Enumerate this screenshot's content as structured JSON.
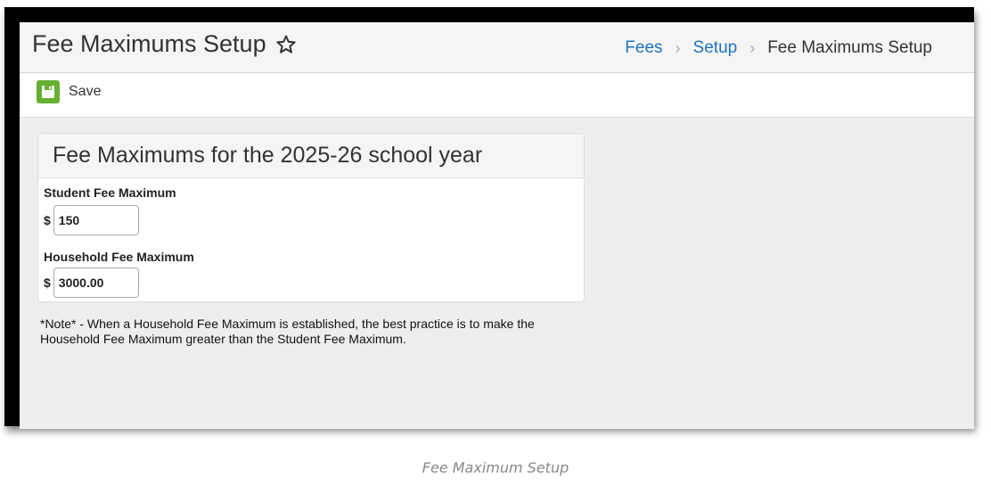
{
  "header": {
    "title": "Fee Maximums Setup",
    "breadcrumb": [
      {
        "label": "Fees",
        "link": true
      },
      {
        "label": "Setup",
        "link": true
      },
      {
        "label": "Fee Maximums Setup",
        "link": false
      }
    ],
    "favorite_icon": "star-outline-icon"
  },
  "toolbar": {
    "save_label": "Save",
    "save_icon": "floppy-disk-icon",
    "accent_color": "#66b032"
  },
  "panel": {
    "title": "Fee Maximums for the 2025-26 school year",
    "student_fee": {
      "label": "Student Fee Maximum",
      "currency": "$",
      "value": "150"
    },
    "household_fee": {
      "label": "Household Fee Maximum",
      "currency": "$",
      "value": "3000.00"
    }
  },
  "note": "*Note* - When a Household Fee Maximum is established, the best practice is to make the Household Fee Maximum greater than the Student Fee Maximum.",
  "caption": "Fee Maximum Setup",
  "colors": {
    "link": "#1e73be",
    "background": "#eeeeee"
  }
}
